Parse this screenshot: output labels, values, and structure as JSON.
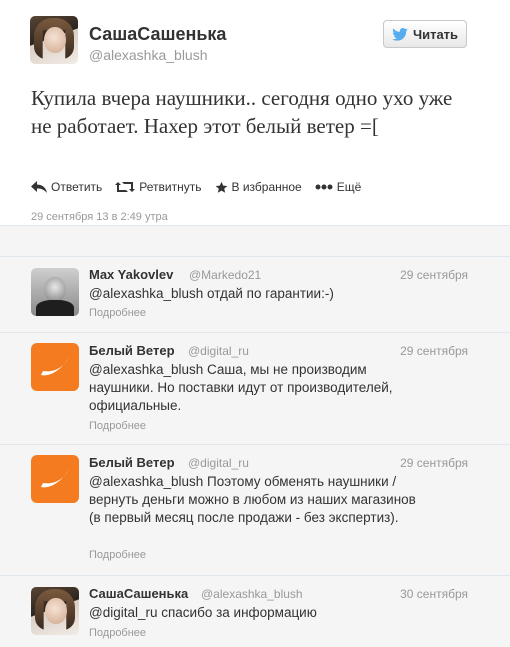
{
  "main_tweet": {
    "display_name": "СашаСашенька",
    "username": "@alexashka_blush",
    "follow_label": "Читать",
    "text": "Купила вчера наушники.. сегодня одно ухо уже не работает. Нахер этот белый ветер =[",
    "actions": {
      "reply": "Ответить",
      "retweet": "Ретвитнуть",
      "favorite": "В избранное",
      "more": "Ещё"
    },
    "timestamp": "29 сентября 13 в 2:49 утра"
  },
  "replies": [
    {
      "name": "Max Yakovlev",
      "handle": "@Markedo21",
      "time": "29 сентября",
      "text": "@alexashka_blush отдай по гарантии:-)",
      "more": "Подробнее"
    },
    {
      "name": "Белый Ветер",
      "handle": "@digital_ru",
      "time": "29 сентября",
      "text": "@alexashka_blush Саша, мы не производим наушники. Но поставки идут от производителей, официальные.",
      "more": "Подробнее"
    },
    {
      "name": "Белый Ветер",
      "handle": "@digital_ru",
      "time": "29 сентября",
      "text": "@alexashka_blush Поэтому обменять наушники / вернуть деньги можно в любом из наших магазинов (в первый месяц после продажи - без экспертиз).",
      "more": "Подробнее"
    },
    {
      "name": "СашаСашенька",
      "handle": "@alexashka_blush",
      "time": "30 сентября",
      "text": "@digital_ru спасибо за информацию",
      "more": "Подробнее"
    }
  ],
  "colors": {
    "twitter_blue": "#55acee",
    "brand_orange": "#f47b20",
    "muted_text": "#999999",
    "reply_bg": "#f5f5f5"
  }
}
